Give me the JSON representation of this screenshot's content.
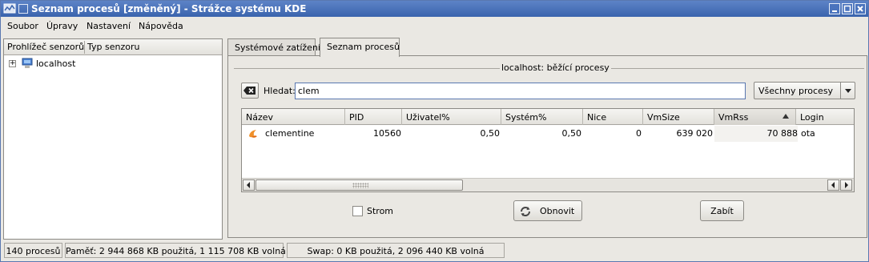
{
  "window": {
    "title": "Seznam procesů [změněný] - Strážce systému KDE",
    "accent": "#3a64ad"
  },
  "menu": {
    "items": [
      "Soubor",
      "Úpravy",
      "Nastavení",
      "Nápověda"
    ]
  },
  "sensor_browser": {
    "columns": [
      "Prohlížeč senzorů",
      "Typ senzoru"
    ],
    "tree": [
      {
        "label": "localhost",
        "icon": "computer-icon",
        "expanded": false
      }
    ]
  },
  "tabs": [
    {
      "label": "Systémové zatížení",
      "active": false
    },
    {
      "label": "Seznam procesů",
      "active": true
    }
  ],
  "process_frame": {
    "title": "localhost: běžící procesy"
  },
  "search": {
    "label": "Hledat:",
    "value": "clem",
    "clear_icon": "clear-text-icon"
  },
  "filter": {
    "selected": "Všechny procesy"
  },
  "table": {
    "columns": [
      "Název",
      "PID",
      "Uživatel%",
      "Systém%",
      "Nice",
      "VmSize",
      "VmRss",
      "Login"
    ],
    "sorted_column": "VmRss",
    "sort_direction": "ascending",
    "rows": [
      {
        "icon": "clementine-icon",
        "name": "clementine",
        "pid": "10560",
        "user_pct": "0,50",
        "system_pct": "0,50",
        "nice": "0",
        "vmsize": "639 020",
        "vmrss": "70 888",
        "login": "ota"
      }
    ]
  },
  "tree_checkbox": {
    "label": "Strom",
    "checked": false
  },
  "buttons": {
    "refresh": "Obnovit",
    "refresh_icon": "refresh-icon",
    "kill": "Zabít"
  },
  "status": {
    "processes": "140 procesů",
    "memory": "Paměť: 2 944 868 KB použitá, 1 115 708 KB volná",
    "swap": "Swap: 0 KB použitá, 2 096 440 KB volná"
  }
}
